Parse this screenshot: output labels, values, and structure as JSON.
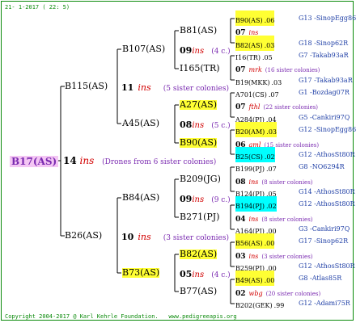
{
  "header": {
    "date": "21- 1-2017 ( 22: 5)"
  },
  "footer": {
    "copyright": "Copyright 2004-2017 @ Karl Kehrle Foundation.",
    "site": "www.pedigreeapis.org"
  },
  "root": {
    "label": "B17(AS)",
    "count": "14",
    "ins": "ins",
    "note": "(Drones from 6 sister colonies)"
  },
  "gen1": [
    {
      "label": "B115(AS)",
      "count": "11",
      "ins": "ins",
      "note": "(5 sister colonies)"
    },
    {
      "label": "B26(AS)",
      "count": "10",
      "ins": "ins",
      "note": "(3 sister colonies)"
    }
  ],
  "gen2": [
    {
      "label": "B107(AS)"
    },
    {
      "label": "A45(AS)"
    },
    {
      "label": "B84(AS)"
    },
    {
      "label": "B73(AS)"
    }
  ],
  "gen3": [
    {
      "label": "B81(AS)",
      "count": "09",
      "ins": "ins",
      "note": "(4 c.)"
    },
    {
      "label": "I165(TR)"
    },
    {
      "label": "A27(AS)",
      "count": "08",
      "ins": "ins",
      "note": "(5 c.)"
    },
    {
      "label": "B90(AS)"
    },
    {
      "label": "B209(JG)",
      "count": "09",
      "ins": "ins",
      "note": "(9 c.)"
    },
    {
      "label": "B271(PJ)"
    },
    {
      "label": "B82(AS)",
      "count": "05",
      "ins": "ins",
      "note": "(4 c.)"
    },
    {
      "label": "B77(AS)"
    }
  ],
  "gen4": [
    {
      "a": "B90(AS)",
      "a_y": ".06",
      "a_r": "G13 -SinopEgg86R"
    },
    {
      "cnt": "07",
      "ins": "ins"
    },
    {
      "a": "B82(AS)",
      "a_y": ".03",
      "a_r": "G18 -Sinop62R"
    },
    {
      "a": "I16(TR)",
      "a_y": ".05",
      "a_r": "G7 -Takab93aR"
    },
    {
      "cnt": "07",
      "ins": "mrk",
      "note": "(16 sister colonies)"
    },
    {
      "a": "B19(MKK)",
      "a_y": ".03",
      "a_r": "G17 -Takab93aR"
    },
    {
      "a": "A701(CS)",
      "a_y": ".07",
      "a_r": "G1 -Bozdag07R"
    },
    {
      "cnt": "07",
      "ins": "fthl",
      "note": "(22 sister colonies)"
    },
    {
      "a": "A284(PJ)",
      "a_y": ".04",
      "a_r": "G5 -Cankiri97Q"
    },
    {
      "a": "B20(AM)",
      "a_y": ".03",
      "a_r": "G12 -SinopEgg86R"
    },
    {
      "cnt": "06",
      "ins": "aml",
      "note": "(15 sister colonies)"
    },
    {
      "a": "B25(CS)",
      "a_y": ".02",
      "a_r": "G12 -AthosSt80R"
    },
    {
      "a": "B199(PJ)",
      "a_y": ".07",
      "a_r": "G8 -NO6294R"
    },
    {
      "cnt": "08",
      "ins": "ins",
      "note": "(8 sister colonies)"
    },
    {
      "a": "B124(PJ)",
      "a_y": ".05",
      "a_r": "G14 -AthosSt80R"
    },
    {
      "a": "B194(PJ)",
      "a_y": ".02",
      "a_r": "G12 -AthosSt80R"
    },
    {
      "cnt": "04",
      "ins": "ins",
      "note": "(8 sister colonies)"
    },
    {
      "a": "A164(PJ)",
      "a_y": ".00",
      "a_r": "G3 -Cankiri97Q"
    },
    {
      "a": "B56(AS)",
      "a_y": ".00",
      "a_r": "G17 -Sinop62R"
    },
    {
      "cnt": "03",
      "ins": "ins",
      "note": "(3 sister colonies)"
    },
    {
      "a": "B259(PJ)",
      "a_y": ".00",
      "a_r": "G12 -AthosSt80R"
    },
    {
      "a": "B49(AS)",
      "a_y": ".00",
      "a_r": "G8 -Atlas85R"
    },
    {
      "cnt": "02",
      "ins": "wbg",
      "note": "(20 sister colonies)"
    },
    {
      "a": "B202(GEK)",
      "a_y": ".99",
      "a_r": "G12 -Adami75R"
    }
  ],
  "colors": {
    "frame": "#0a8a0a",
    "ins": "#d20000",
    "note": "#7a2ab0",
    "ref": "#1f3fa6",
    "yellow": "#ffff33",
    "cyan": "#00ffff",
    "root_bg": "#f4c6f4"
  }
}
